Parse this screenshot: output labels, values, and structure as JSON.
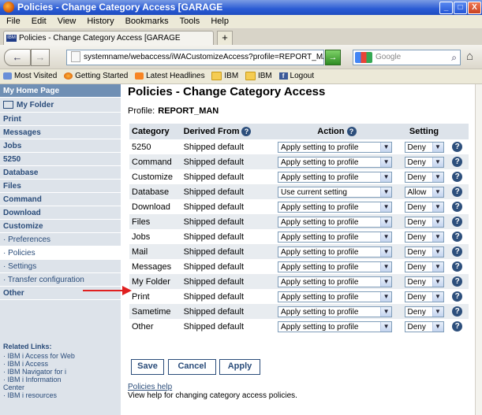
{
  "window": {
    "title": "Policies - Change Category Access [GARAGE"
  },
  "menu": [
    "File",
    "Edit",
    "View",
    "History",
    "Bookmarks",
    "Tools",
    "Help"
  ],
  "tab": {
    "label": "Policies - Change Category Access [GARAGE"
  },
  "address": {
    "url": "systemname/webaccess/iWACustomizeAccess?profile=REPORT_MA",
    "search_placeholder": "Google"
  },
  "bookmarks": [
    "Most Visited",
    "Getting Started",
    "Latest Headlines",
    "IBM",
    "IBM",
    "Logout"
  ],
  "sidebar": {
    "items": [
      {
        "label": "My Home Page"
      },
      {
        "label": "My Folder"
      },
      {
        "label": "Print"
      },
      {
        "label": "Messages"
      },
      {
        "label": "Jobs"
      },
      {
        "label": "5250"
      },
      {
        "label": "Database"
      },
      {
        "label": "Files"
      },
      {
        "label": "Command"
      },
      {
        "label": "Download"
      },
      {
        "label": "Customize"
      },
      {
        "label": "· Preferences"
      },
      {
        "label": "· Policies"
      },
      {
        "label": "· Settings"
      },
      {
        "label": "· Transfer configuration"
      },
      {
        "label": "Other"
      }
    ],
    "related_title": "Related Links:",
    "related": [
      "· IBM i Access for Web",
      "· IBM i Access",
      "· IBM Navigator for i",
      "· IBM i Information",
      "   Center",
      "· IBM i resources"
    ]
  },
  "page": {
    "title": "Policies - Change Category Access",
    "profile_label": "Profile:",
    "profile_value": "REPORT_MAN",
    "columns": [
      "Category",
      "Derived From",
      "Action",
      "Setting"
    ],
    "rows": [
      {
        "category": "5250",
        "derived": "Shipped default",
        "action": "Apply setting to profile",
        "setting": "Deny"
      },
      {
        "category": "Command",
        "derived": "Shipped default",
        "action": "Apply setting to profile",
        "setting": "Deny"
      },
      {
        "category": "Customize",
        "derived": "Shipped default",
        "action": "Apply setting to profile",
        "setting": "Deny"
      },
      {
        "category": "Database",
        "derived": "Shipped default",
        "action": "Use current setting",
        "setting": "Allow"
      },
      {
        "category": "Download",
        "derived": "Shipped default",
        "action": "Apply setting to profile",
        "setting": "Deny"
      },
      {
        "category": "Files",
        "derived": "Shipped default",
        "action": "Apply setting to profile",
        "setting": "Deny"
      },
      {
        "category": "Jobs",
        "derived": "Shipped default",
        "action": "Apply setting to profile",
        "setting": "Deny"
      },
      {
        "category": "Mail",
        "derived": "Shipped default",
        "action": "Apply setting to profile",
        "setting": "Deny"
      },
      {
        "category": "Messages",
        "derived": "Shipped default",
        "action": "Apply setting to profile",
        "setting": "Deny"
      },
      {
        "category": "My Folder",
        "derived": "Shipped default",
        "action": "Apply setting to profile",
        "setting": "Deny"
      },
      {
        "category": "Print",
        "derived": "Shipped default",
        "action": "Apply setting to profile",
        "setting": "Deny"
      },
      {
        "category": "Sametime",
        "derived": "Shipped default",
        "action": "Apply setting to profile",
        "setting": "Deny"
      },
      {
        "category": "Other",
        "derived": "Shipped default",
        "action": "Apply setting to profile",
        "setting": "Deny"
      }
    ],
    "buttons": {
      "save": "Save",
      "cancel": "Cancel",
      "apply": "Apply"
    },
    "help_link": "Policies help",
    "help_text": "View help for changing category access policies."
  },
  "colors": {
    "sidebar_bg": "#dde3ea",
    "accent": "#2a4c7a",
    "annotation": "#e02020"
  }
}
